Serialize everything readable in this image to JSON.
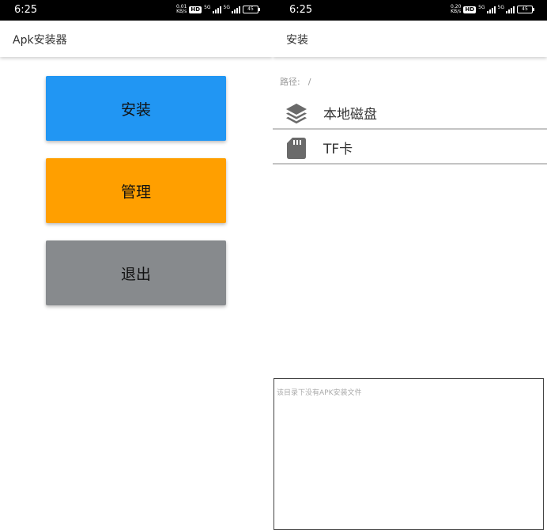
{
  "left_screen": {
    "status_bar": {
      "time": "6:25",
      "net_rate": "0.01",
      "net_unit": "KB/s",
      "hd": "HD",
      "sig1": "5G",
      "sig2": "5G",
      "battery": "45"
    },
    "app_bar": {
      "title": "Apk安装器"
    },
    "buttons": {
      "install": {
        "label": "安装",
        "color": "#2196f3"
      },
      "manage": {
        "label": "管理",
        "color": "#ff9f00"
      },
      "exit": {
        "label": "退出",
        "color": "#878a8d"
      }
    }
  },
  "right_screen": {
    "status_bar": {
      "time": "6:25",
      "net_rate": "0.20",
      "net_unit": "KB/s",
      "hd": "HD",
      "sig1": "5G",
      "sig2": "5G",
      "battery": "45"
    },
    "app_bar": {
      "title": "安装"
    },
    "path": {
      "label": "路径:",
      "value": "/"
    },
    "items": [
      {
        "label": "本地磁盘",
        "icon": "layers-icon"
      },
      {
        "label": "TF卡",
        "icon": "sd-card-icon"
      }
    ],
    "log": {
      "message": "该目录下没有APK安装文件"
    }
  }
}
